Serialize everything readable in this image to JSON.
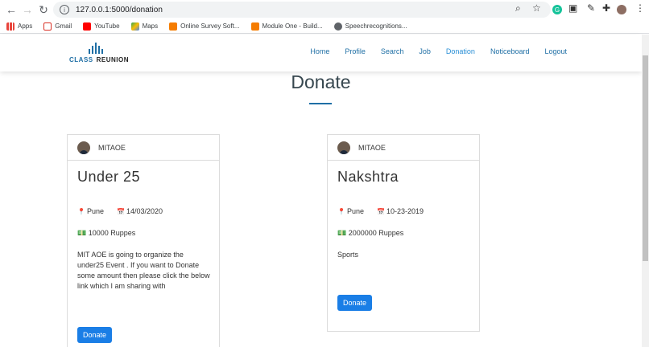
{
  "browser": {
    "url": "127.0.0.1:5000/donation",
    "bookmarks": [
      "Apps",
      "Gmail",
      "YouTube",
      "Maps",
      "Online Survey Soft...",
      "Module One - Build...",
      "Speechrecognitions..."
    ]
  },
  "site": {
    "logo_word1": "CLASS",
    "logo_word2": "REUNION",
    "menu": [
      "Home",
      "Profile",
      "Search",
      "Job",
      "Donation",
      "Noticeboard",
      "Logout"
    ]
  },
  "page": {
    "title": "Donate"
  },
  "cards": [
    {
      "user": "MITAOE",
      "title": "Under 25",
      "location": "Pune",
      "date": "14/03/2020",
      "amount": "10000 Ruppes",
      "description": "MIT AOE is going to organize the under25 Event . If you want to Donate some amount then please click the below link which I am sharing with",
      "button": "Donate"
    },
    {
      "user": "MITAOE",
      "title": "Nakshtra",
      "location": "Pune",
      "date": "10-23-2019",
      "amount": "2000000 Ruppes",
      "description": "Sports",
      "button": "Donate"
    }
  ],
  "icons": {
    "map_marker": "map-marker-icon",
    "calendar": "calendar-icon",
    "money": "money-icon"
  }
}
